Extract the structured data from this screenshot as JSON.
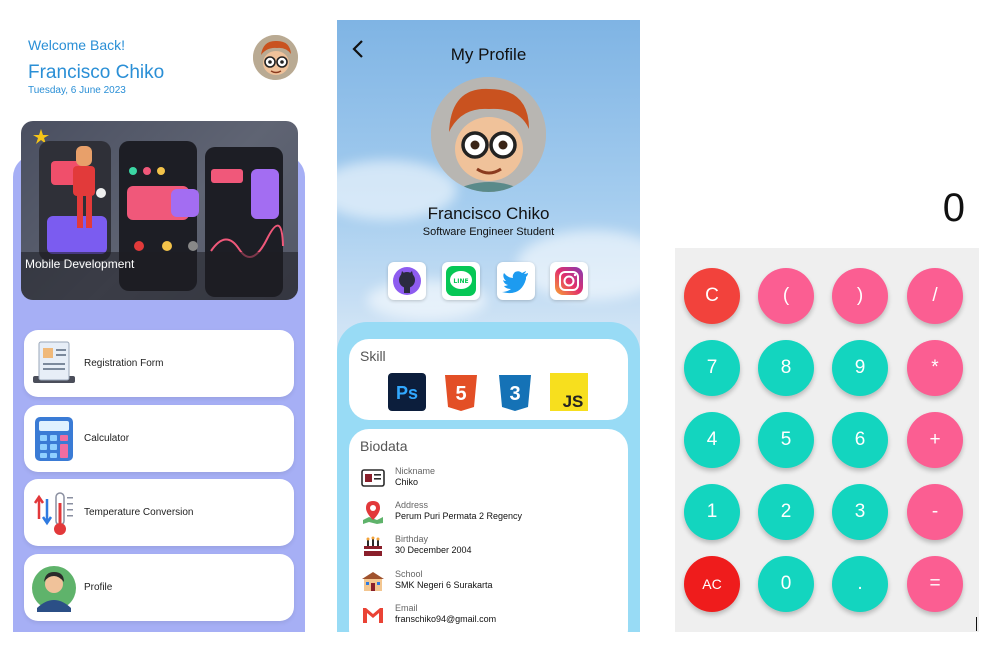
{
  "home": {
    "welcome": "Welcome Back!",
    "user_name": "Francisco Chiko",
    "date": "Tuesday, 6 June 2023",
    "banner_caption": "Mobile Development",
    "menu": [
      {
        "label": "Registration Form",
        "icon": "registration-form-icon"
      },
      {
        "label": "Calculator",
        "icon": "calculator-icon"
      },
      {
        "label": "Temperature Conversion",
        "icon": "thermometer-icon"
      },
      {
        "label": "Profile",
        "icon": "person-icon"
      }
    ],
    "colors": {
      "accent": "#2a8fd6",
      "panel": "#a6aff5"
    }
  },
  "profile": {
    "title": "My Profile",
    "name": "Francisco Chiko",
    "role": "Software Engineer Student",
    "socials": [
      "github-icon",
      "line-icon",
      "twitter-icon",
      "instagram-icon"
    ],
    "skill_title": "Skill",
    "skills": [
      {
        "label": "Ps",
        "icon": "photoshop-icon"
      },
      {
        "label": "5",
        "icon": "html5-icon"
      },
      {
        "label": "3",
        "icon": "css3-icon"
      },
      {
        "label": "JS",
        "icon": "javascript-icon"
      }
    ],
    "bio_title": "Biodata",
    "bio": [
      {
        "label": "Nickname",
        "value": "Chiko",
        "icon": "id-card-icon"
      },
      {
        "label": "Address",
        "value": "Perum Puri Permata 2 Regency",
        "icon": "map-pin-icon"
      },
      {
        "label": "Birthday",
        "value": "30 December 2004",
        "icon": "birthday-cake-icon"
      },
      {
        "label": "School",
        "value": "SMK Negeri 6 Surakarta",
        "icon": "school-icon"
      },
      {
        "label": "Email",
        "value": "franschiko94@gmail.com",
        "icon": "gmail-icon"
      }
    ]
  },
  "calculator": {
    "display": "0",
    "keys": [
      [
        "C",
        "(",
        ")",
        "/"
      ],
      [
        "7",
        "8",
        "9",
        "*"
      ],
      [
        "4",
        "5",
        "6",
        "+"
      ],
      [
        "1",
        "2",
        "3",
        "-"
      ],
      [
        "AC",
        "0",
        ".",
        "="
      ]
    ],
    "colors": {
      "clear": "#f2423c",
      "ac": "#ef1c1c",
      "number": "#13d5bf",
      "operator": "#fb5e92"
    }
  }
}
